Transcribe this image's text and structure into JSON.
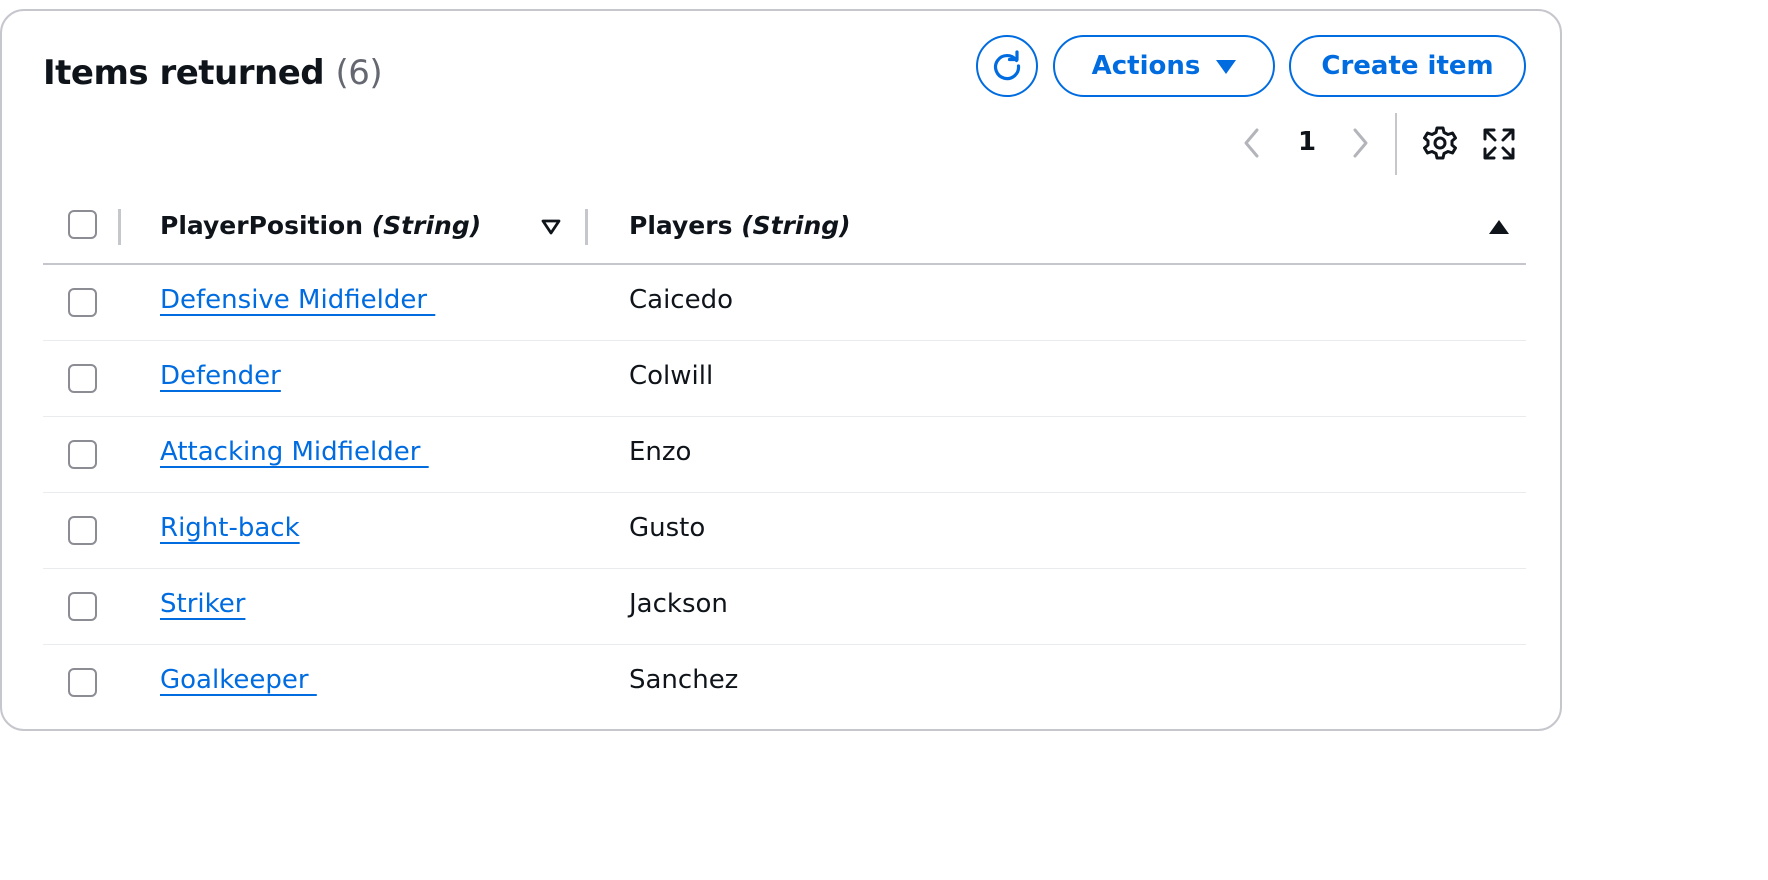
{
  "header": {
    "title": "Items returned",
    "count": "(6)"
  },
  "toolbar": {
    "refresh_icon": "refresh-icon",
    "actions_label": "Actions",
    "create_label": "Create item"
  },
  "pagination": {
    "current_page": "1",
    "prev_icon": "chevron-left-icon",
    "next_icon": "chevron-right-icon",
    "settings_icon": "gear-icon",
    "fullscreen_icon": "expand-icon"
  },
  "table": {
    "columns": [
      {
        "name": "PlayerPosition",
        "type": "(String)",
        "sort": "descending-outline"
      },
      {
        "name": "Players",
        "type": "(String)",
        "sort": "ascending"
      }
    ],
    "rows": [
      {
        "position": "Defensive Midfielder ",
        "player": "Caicedo"
      },
      {
        "position": "Defender",
        "player": "Colwill"
      },
      {
        "position": "Attacking Midfielder ",
        "player": "Enzo"
      },
      {
        "position": "Right-back",
        "player": "Gusto"
      },
      {
        "position": "Striker",
        "player": "Jackson"
      },
      {
        "position": "Goalkeeper ",
        "player": "Sanchez"
      }
    ]
  },
  "colors": {
    "accent": "#006ce0",
    "border": "#c6c6cd",
    "text": "#0f141a",
    "muted": "#656871"
  }
}
